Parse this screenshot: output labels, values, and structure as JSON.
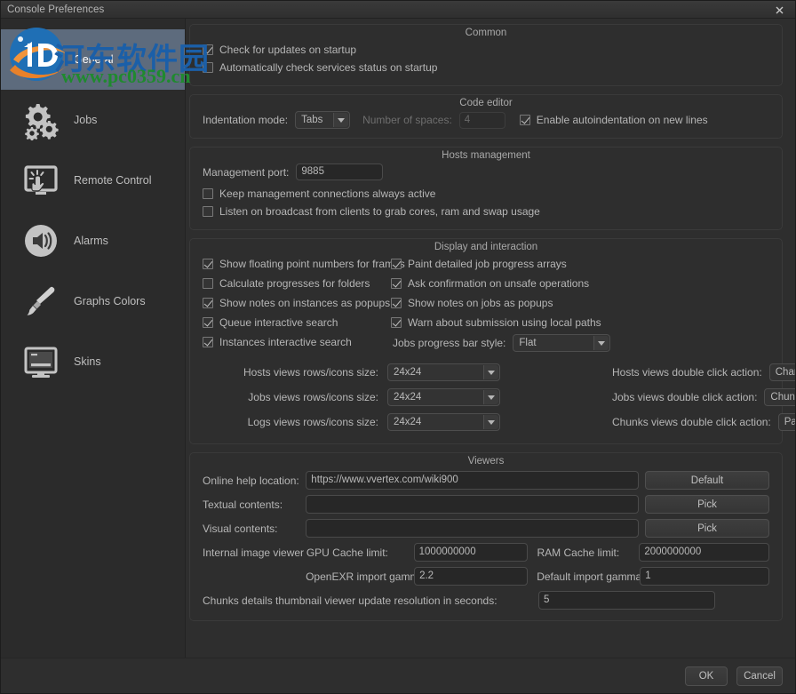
{
  "window": {
    "title": "Console Preferences",
    "close_icon": "close-icon"
  },
  "sidebar": {
    "items": [
      {
        "label": "General",
        "icon": "sliders-icon",
        "selected": true
      },
      {
        "label": "Jobs",
        "icon": "gears-icon",
        "selected": false
      },
      {
        "label": "Remote Control",
        "icon": "remote-control-icon",
        "selected": false
      },
      {
        "label": "Alarms",
        "icon": "speaker-icon",
        "selected": false
      },
      {
        "label": "Graphs Colors",
        "icon": "paintbrush-icon",
        "selected": false
      },
      {
        "label": "Skins",
        "icon": "monitor-icon",
        "selected": false
      }
    ]
  },
  "common": {
    "title": "Common",
    "check_updates": {
      "label": "Check for updates on startup",
      "checked": true
    },
    "auto_services": {
      "label": "Automatically check services status on startup",
      "checked": false
    }
  },
  "code_editor": {
    "title": "Code editor",
    "indentation_label": "Indentation mode:",
    "indentation_value": "Tabs",
    "spaces_label": "Number of spaces:",
    "spaces_value": "4",
    "autoindent": {
      "label": "Enable autoindentation on new lines",
      "checked": true
    }
  },
  "hosts_management": {
    "title": "Hosts management",
    "port_label": "Management port:",
    "port_value": "9885",
    "keep_connections": {
      "label": "Keep management connections always active",
      "checked": false
    },
    "listen_broadcast": {
      "label": "Listen on broadcast from clients to grab cores, ram and swap usage",
      "checked": false
    }
  },
  "display": {
    "title": "Display and interaction",
    "left": [
      {
        "label": "Show floating point numbers for frames",
        "checked": true
      },
      {
        "label": "Calculate progresses for folders",
        "checked": false
      },
      {
        "label": "Show notes on instances as popups",
        "checked": true
      },
      {
        "label": "Queue interactive search",
        "checked": true
      },
      {
        "label": "Instances interactive search",
        "checked": true
      }
    ],
    "right": [
      {
        "label": "Paint detailed job progress arrays",
        "checked": true
      },
      {
        "label": "Ask confirmation on unsafe operations",
        "checked": true
      },
      {
        "label": "Show notes on jobs as popups",
        "checked": true
      },
      {
        "label": "Warn about submission using local paths",
        "checked": true
      }
    ],
    "progress_style_label": "Jobs progress bar style:",
    "progress_style_value": "Flat",
    "sizes": [
      {
        "label": "Hosts views rows/icons size:",
        "value": "24x24"
      },
      {
        "label": "Jobs views rows/icons size:",
        "value": "24x24"
      },
      {
        "label": "Logs views rows/icons size:",
        "value": "24x24"
      }
    ],
    "actions": [
      {
        "label": "Hosts views double click action:",
        "value": "Change status"
      },
      {
        "label": "Jobs views double click action:",
        "value": "Chunks detail"
      },
      {
        "label": "Chunks views double click action:",
        "value": "Parse chunk's log"
      }
    ]
  },
  "viewers": {
    "title": "Viewers",
    "online_help_label": "Online help location:",
    "online_help_value": "https://www.vvertex.com/wiki900",
    "online_help_button": "Default",
    "textual_label": "Textual contents:",
    "textual_value": "",
    "textual_button": "Pick",
    "visual_label": "Visual contents:",
    "visual_value": "",
    "visual_button": "Pick",
    "internal_viewer_label": "Internal image viewer",
    "gpu_cache_label": "GPU Cache limit:",
    "gpu_cache_value": "1000000000",
    "ram_cache_label": "RAM Cache limit:",
    "ram_cache_value": "2000000000",
    "openexr_gamma_label": "OpenEXR import gamma:",
    "openexr_gamma_value": "2.2",
    "default_gamma_label": "Default import gamma:",
    "default_gamma_value": "1",
    "chunks_thumb_label": "Chunks details thumbnail viewer update resolution in seconds:",
    "chunks_thumb_value": "5"
  },
  "footer": {
    "ok": "OK",
    "cancel": "Cancel"
  },
  "watermark": {
    "chinese": "河东软件园",
    "url": "www.pc0359.cn"
  },
  "colors": {
    "selection": "#5d6b7d",
    "window_bg": "#2e2e2e",
    "text": "#b6b6b6",
    "watermark_blue": "#1b5fa8",
    "watermark_green": "#1f8a2e"
  }
}
